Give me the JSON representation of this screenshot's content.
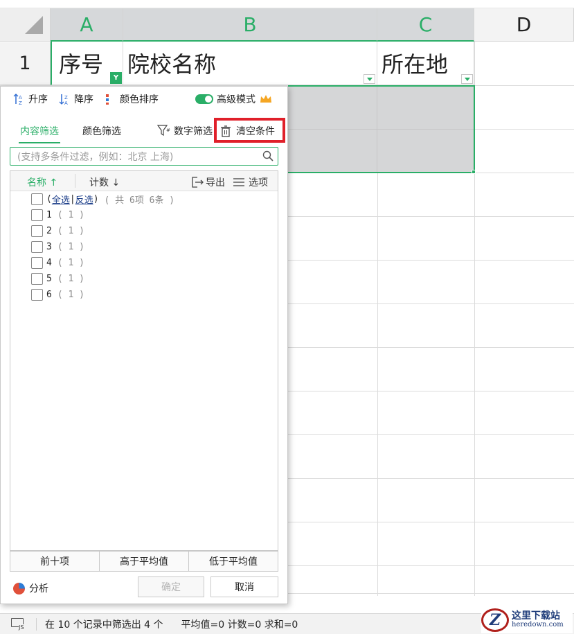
{
  "spreadsheet": {
    "columns": [
      "A",
      "B",
      "C",
      "D"
    ],
    "row_numbers": [
      "1"
    ],
    "header_cells": {
      "a1": "序号",
      "b1": "院校名称",
      "c1": "所在地"
    }
  },
  "filter_panel": {
    "toolbar": {
      "sort_asc": "升序",
      "sort_desc": "降序",
      "color_sort": "颜色排序",
      "advanced_mode": "高级模式"
    },
    "tabs": {
      "content_filter": "内容筛选",
      "color_filter": "颜色筛选",
      "number_filter": "数字筛选",
      "clear_conditions": "清空条件"
    },
    "search_placeholder": "(支持多条件过滤，例如：北京 上海)",
    "list_header": {
      "name": "名称",
      "count": "计数",
      "export": "导出",
      "options": "选项"
    },
    "select_all": {
      "open_paren": "(",
      "all": "全选",
      "divider": "|",
      "invert": "反选",
      "close_paren": ")",
      "summary": "( 共 6项 6条 )"
    },
    "items": [
      {
        "label": "1",
        "count": "( 1 )"
      },
      {
        "label": "2",
        "count": "( 1 )"
      },
      {
        "label": "3",
        "count": "( 1 )"
      },
      {
        "label": "4",
        "count": "( 1 )"
      },
      {
        "label": "5",
        "count": "( 1 )"
      },
      {
        "label": "6",
        "count": "( 1 )"
      }
    ],
    "quick_buttons": {
      "top_ten": "前十项",
      "above_avg": "高于平均值",
      "below_avg": "低于平均值"
    },
    "analysis": "分析",
    "confirm": "确定",
    "cancel": "取消"
  },
  "status_bar": {
    "filter_info": "在 10 个记录中筛选出 4 个",
    "stats": "平均值=0 计数=0 求和=0"
  },
  "watermark": {
    "title": "这里下载站",
    "url": "heredown.com"
  },
  "colors": {
    "accent_green": "#2aae67",
    "highlight_red": "#e0202a"
  }
}
